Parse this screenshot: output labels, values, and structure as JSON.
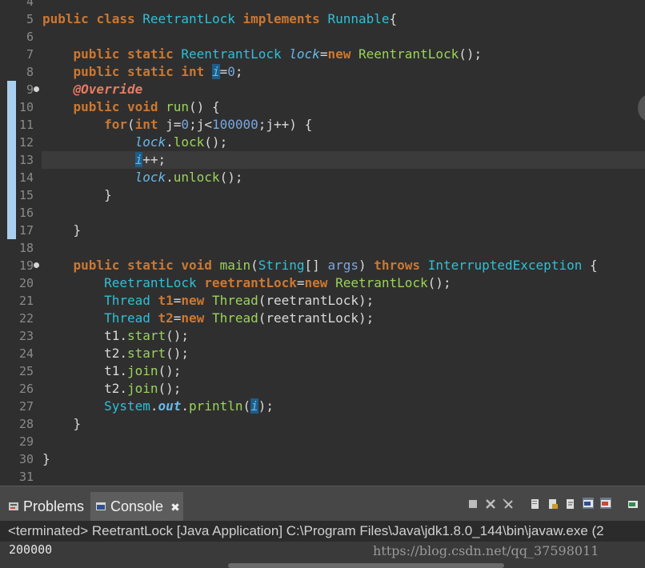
{
  "editor": {
    "lines": [
      {
        "n": "4",
        "html": ""
      },
      {
        "n": "5",
        "html": "<span class='kw'>public</span> <span class='kw'>class</span> <span class='ty'>ReetrantLock</span> <span class='kw'>implements</span> <span class='ty'>Runnable</span>{"
      },
      {
        "n": "6",
        "html": ""
      },
      {
        "n": "7",
        "html": "    <span class='kw'>public</span> <span class='kw'>static</span> <span class='ty'>ReentrantLock</span> <span class='fld'>lock</span>=<span class='kw'>new</span> <span class='mth'>ReentrantLock</span>();"
      },
      {
        "n": "8",
        "html": "    <span class='kw'>public</span> <span class='kw'>static</span> <span class='kw'>int</span> <span class='fld hlw'>i</span>=<span class='num'>0</span>;"
      },
      {
        "n": "9",
        "html": "    <span class='ann'>@Override</span>"
      },
      {
        "n": "10",
        "html": "    <span class='kw'>public</span> <span class='kw'>void</span> <span class='mth'>run</span>() {"
      },
      {
        "n": "11",
        "html": "        <span class='kw'>for</span>(<span class='kw'>int</span> j=<span class='num'>0</span>;j&lt;<span class='num'>100000</span>;j++) {"
      },
      {
        "n": "12",
        "html": "            <span class='fld'>lock</span>.<span class='mth'>lock</span>();"
      },
      {
        "n": "13",
        "html": "            <span class='fld hlw'>i</span>++;"
      },
      {
        "n": "14",
        "html": "            <span class='fld'>lock</span>.<span class='mth'>unlock</span>();"
      },
      {
        "n": "15",
        "html": "        }"
      },
      {
        "n": "16",
        "html": ""
      },
      {
        "n": "17",
        "html": "    }"
      },
      {
        "n": "18",
        "html": ""
      },
      {
        "n": "19",
        "html": "    <span class='kw'>public</span> <span class='kw'>static</span> <span class='kw'>void</span> <span class='mth'>main</span>(<span class='ty'>String</span>[] <span class='num'>args</span>) <span class='kw'>throws</span> <span class='ty'>InterruptedException</span> {"
      },
      {
        "n": "20",
        "html": "        <span class='ty'>ReetrantLock</span> <span class='kw'>reetrantLock</span>=<span class='kw'>new</span> <span class='mth'>ReetrantLock</span>();"
      },
      {
        "n": "21",
        "html": "        <span class='ty'>Thread</span> <span class='kw'>t1</span>=<span class='kw'>new</span> <span class='mth'>Thread</span>(reetrantLock);"
      },
      {
        "n": "22",
        "html": "        <span class='ty'>Thread</span> <span class='kw'>t2</span>=<span class='kw'>new</span> <span class='mth'>Thread</span>(reetrantLock);"
      },
      {
        "n": "23",
        "html": "        t1.<span class='mth'>start</span>();"
      },
      {
        "n": "24",
        "html": "        t2.<span class='mth'>start</span>();"
      },
      {
        "n": "25",
        "html": "        t1.<span class='mth'>join</span>();"
      },
      {
        "n": "26",
        "html": "        t2.<span class='mth'>join</span>();"
      },
      {
        "n": "27",
        "html": "        <span class='ty'>System</span>.<span class='sf'>out</span>.<span class='mth'>println</span>(<span class='fld hlw'>i</span>);"
      },
      {
        "n": "28",
        "html": "    }"
      },
      {
        "n": "29",
        "html": ""
      },
      {
        "n": "30",
        "html": "}"
      },
      {
        "n": "31",
        "html": ""
      }
    ]
  },
  "panel": {
    "tabs": [
      {
        "label": "Problems",
        "icon": "problems-icon"
      },
      {
        "label": "Console",
        "icon": "console-icon",
        "active": true
      }
    ],
    "close_glyph": "✖",
    "status": "<terminated> ReetrantLock [Java Application] C:\\Program Files\\Java\\jdk1.8.0_144\\bin\\javaw.exe (2",
    "output": "200000",
    "watermark": "https://blog.csdn.net/qq_37598011"
  }
}
